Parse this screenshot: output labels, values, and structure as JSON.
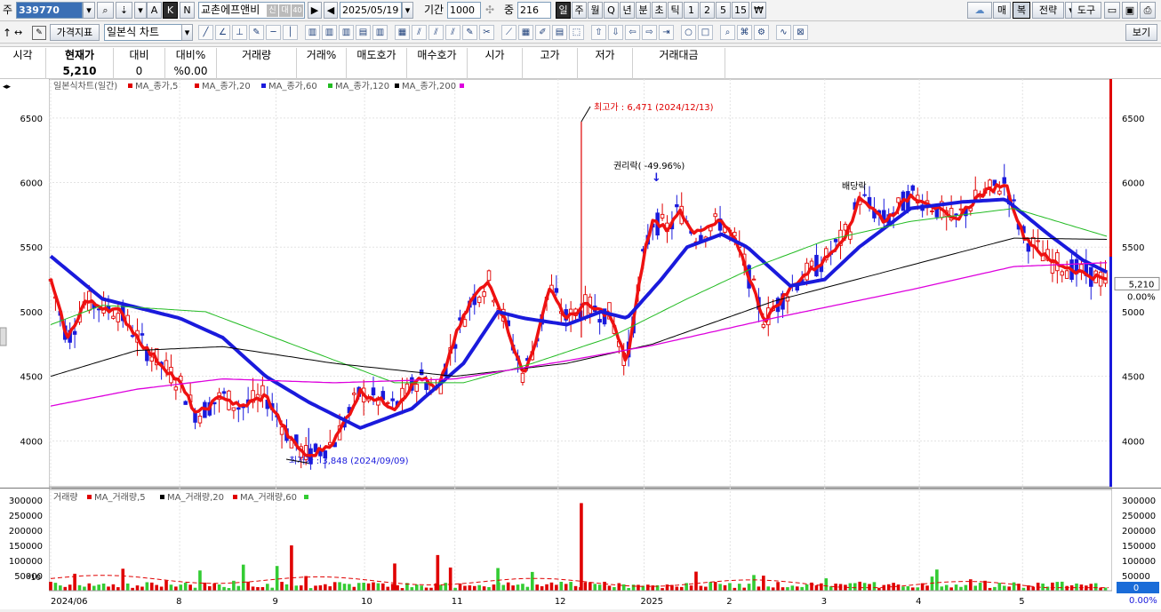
{
  "toolbar1": {
    "market_label": "주",
    "code": "339770",
    "mode_a": "A",
    "mode_k": "K",
    "mode_n": "N",
    "stock_name": "교촌에프앤비",
    "badge_credit": "신",
    "badge_loan": "대",
    "badge_40": "40",
    "date": "2025/05/19",
    "period_label": "기간",
    "period_value": "1000",
    "count_label": "중",
    "count_value": "216",
    "periods": [
      "일",
      "주",
      "월",
      "Q",
      "년",
      "분",
      "초",
      "틱",
      "1",
      "2",
      "5",
      "15"
    ],
    "right_buttons": [
      "매",
      "복",
      "전략",
      "도구"
    ]
  },
  "toolbar2": {
    "price_index_label": "가격지표",
    "chart_type_value": "일본식 차트",
    "view_label": "보기"
  },
  "quote": {
    "headers": [
      "시각",
      "현재가",
      "대비",
      "대비%",
      "거래량",
      "거래%",
      "매도호가",
      "매수호가",
      "시가",
      "고가",
      "저가",
      "거래대금"
    ],
    "values": [
      "",
      "5,210",
      "0",
      "%0.00",
      "",
      "",
      "",
      "",
      "",
      "",
      "",
      ""
    ]
  },
  "price_panel": {
    "legend_title": "일본식차트(일간)",
    "legend": [
      {
        "name": "MA_종가,5",
        "color": "#e00000"
      },
      {
        "name": "MA_종가,20",
        "color": "#e00000"
      },
      {
        "name": "MA_종가,60",
        "color": "#1a1adc"
      },
      {
        "name": "MA_종가,120",
        "color": "#22bb22"
      },
      {
        "name": "MA_종가,200",
        "color": "#000000"
      }
    ],
    "y_ticks": [
      "6500",
      "6000",
      "5500",
      "5000",
      "4500",
      "4000"
    ],
    "high_annotation": "최고가 : 6,471 (2024/12/13)",
    "low_annotation": "최저가 : 3,848 (2024/09/09)",
    "rights_annotation": "권리락( -49.96%)",
    "dividend_annotation": "배당락",
    "current_price": "5,210",
    "current_pct": "0.00%"
  },
  "volume_panel": {
    "legend_title": "거래량",
    "legend": [
      {
        "name": "MA_거래량,5",
        "color": "#e00000"
      },
      {
        "name": "MA_거래량,20",
        "color": "#000000"
      },
      {
        "name": "MA_거래량,60",
        "color": "#e00000"
      }
    ],
    "y_ticks": [
      "300000",
      "250000",
      "200000",
      "150000",
      "100000",
      "50000"
    ],
    "scale_note": "*10",
    "current_volume": "0",
    "current_pct": "0.00%"
  },
  "x_axis": {
    "labels": [
      "2024/06",
      "8",
      "9",
      "10",
      "11",
      "12",
      "2025",
      "2",
      "3",
      "4",
      "5"
    ]
  },
  "chart_data": {
    "type": "candlestick",
    "series": [
      {
        "name": "MA_종가,5",
        "anchors": [
          [
            0,
            5240
          ],
          [
            20,
            4790
          ],
          [
            40,
            5080
          ],
          [
            80,
            5000
          ],
          [
            110,
            4720
          ],
          [
            150,
            4450
          ],
          [
            170,
            4200
          ],
          [
            200,
            4350
          ],
          [
            220,
            4260
          ],
          [
            250,
            4350
          ],
          [
            280,
            4000
          ],
          [
            300,
            3870
          ],
          [
            330,
            4000
          ],
          [
            360,
            4380
          ],
          [
            400,
            4260
          ],
          [
            430,
            4500
          ],
          [
            450,
            4380
          ],
          [
            470,
            4800
          ],
          [
            490,
            5100
          ],
          [
            510,
            5240
          ],
          [
            530,
            4900
          ],
          [
            550,
            4500
          ],
          [
            570,
            4900
          ],
          [
            580,
            5200
          ],
          [
            600,
            4940
          ],
          [
            620,
            5050
          ],
          [
            650,
            4980
          ],
          [
            670,
            4600
          ],
          [
            690,
            5450
          ],
          [
            700,
            5700
          ],
          [
            720,
            5640
          ],
          [
            730,
            5800
          ],
          [
            750,
            5600
          ],
          [
            780,
            5700
          ],
          [
            800,
            5500
          ],
          [
            830,
            4930
          ],
          [
            850,
            5100
          ],
          [
            870,
            5250
          ],
          [
            900,
            5400
          ],
          [
            930,
            5650
          ],
          [
            940,
            5900
          ],
          [
            970,
            5700
          ],
          [
            1000,
            5900
          ],
          [
            1020,
            5850
          ],
          [
            1050,
            5700
          ],
          [
            1080,
            5900
          ],
          [
            1110,
            6000
          ],
          [
            1130,
            5600
          ],
          [
            1160,
            5400
          ],
          [
            1200,
            5300
          ],
          [
            1230,
            5240
          ]
        ]
      },
      {
        "name": "MA_종가,60",
        "anchors": [
          [
            0,
            5430
          ],
          [
            60,
            5100
          ],
          [
            150,
            4950
          ],
          [
            200,
            4800
          ],
          [
            250,
            4500
          ],
          [
            300,
            4300
          ],
          [
            360,
            4100
          ],
          [
            420,
            4250
          ],
          [
            480,
            4600
          ],
          [
            520,
            5000
          ],
          [
            550,
            4950
          ],
          [
            600,
            4900
          ],
          [
            640,
            5000
          ],
          [
            670,
            4950
          ],
          [
            710,
            5250
          ],
          [
            740,
            5500
          ],
          [
            780,
            5600
          ],
          [
            810,
            5500
          ],
          [
            860,
            5200
          ],
          [
            900,
            5250
          ],
          [
            940,
            5500
          ],
          [
            1000,
            5800
          ],
          [
            1060,
            5850
          ],
          [
            1110,
            5870
          ],
          [
            1160,
            5600
          ],
          [
            1200,
            5400
          ],
          [
            1230,
            5300
          ]
        ]
      },
      {
        "name": "MA_종가,120",
        "anchors": [
          [
            0,
            4900
          ],
          [
            60,
            5050
          ],
          [
            180,
            5000
          ],
          [
            300,
            4700
          ],
          [
            400,
            4450
          ],
          [
            480,
            4450
          ],
          [
            560,
            4600
          ],
          [
            650,
            4800
          ],
          [
            740,
            5100
          ],
          [
            820,
            5350
          ],
          [
            900,
            5550
          ],
          [
            1000,
            5700
          ],
          [
            1120,
            5800
          ],
          [
            1230,
            5580
          ]
        ]
      },
      {
        "name": "MA_종가,200",
        "anchors": [
          [
            0,
            4500
          ],
          [
            100,
            4700
          ],
          [
            200,
            4730
          ],
          [
            330,
            4600
          ],
          [
            470,
            4500
          ],
          [
            600,
            4600
          ],
          [
            700,
            4750
          ],
          [
            840,
            5080
          ],
          [
            1000,
            5360
          ],
          [
            1120,
            5570
          ],
          [
            1230,
            5560
          ]
        ]
      },
      {
        "name": "MA_종가,200 (magenta)",
        "anchors": [
          [
            0,
            4270
          ],
          [
            100,
            4400
          ],
          [
            200,
            4480
          ],
          [
            330,
            4450
          ],
          [
            470,
            4480
          ],
          [
            600,
            4620
          ],
          [
            700,
            4740
          ],
          [
            840,
            4950
          ],
          [
            1000,
            5170
          ],
          [
            1120,
            5350
          ],
          [
            1230,
            5380
          ]
        ]
      }
    ],
    "price_range": [
      3700,
      6650
    ],
    "volume_range": [
      0,
      300000
    ],
    "high": {
      "value": 6471,
      "date": "2024/12/13"
    },
    "low": {
      "value": 3848,
      "date": "2024/09/09"
    },
    "last_close": 5210
  }
}
